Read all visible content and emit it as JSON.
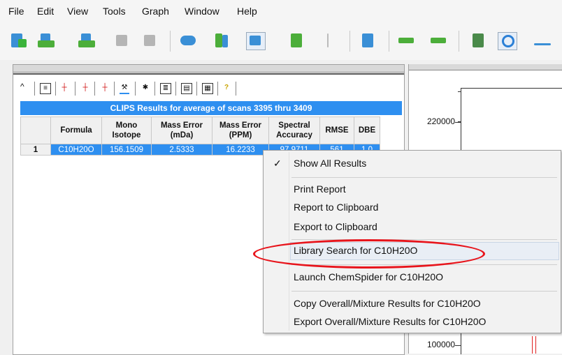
{
  "menu": [
    "File",
    "Edit",
    "View",
    "Tools",
    "Graph",
    "Window",
    "Help"
  ],
  "toolbar_icons": [
    "add-file-icon",
    "open-icon",
    "open-folder-icon",
    "save-icon",
    "copy-icon",
    "library-icon",
    "book-icon",
    "spectrum-icon",
    "document-icon",
    "peaks-icon",
    "chart-icon",
    "back-arrow-icon",
    "forward-arrow-icon",
    "integrate-icon",
    "search-icon",
    "baseline-icon"
  ],
  "mini_toolbar": {
    "caret": "^",
    "icons": [
      "list-icon",
      "peak-icon",
      "peak-range-icon",
      "peak-compare-icon",
      "tools-icon",
      "wand-icon",
      "stack-icon",
      "table-icon",
      "grid-icon",
      "help-icon"
    ],
    "help_label": "?"
  },
  "results": {
    "banner": "CLIPS Results for average of scans 3395 thru 3409",
    "headers": [
      {
        "l1": "Formula",
        "l2": ""
      },
      {
        "l1": "Mono",
        "l2": "Isotope"
      },
      {
        "l1": "Mass Error",
        "l2": "(mDa)"
      },
      {
        "l1": "Mass Error",
        "l2": "(PPM)"
      },
      {
        "l1": "Spectral",
        "l2": "Accuracy"
      },
      {
        "l1": "RMSE",
        "l2": ""
      },
      {
        "l1": "DBE",
        "l2": ""
      }
    ],
    "rows": [
      {
        "num": "1",
        "formula": "C10H20O",
        "mono": "156.1509",
        "err_mda": "2.5333",
        "err_ppm": "16.2233",
        "accuracy": "97.9711",
        "rmse": "561",
        "dbe": "1.0"
      }
    ]
  },
  "chart": {
    "y_tick_labels": [
      "220000",
      "100000"
    ]
  },
  "context_menu": {
    "items": [
      {
        "label": "Show All Results",
        "checked": true
      },
      {
        "label": "Print Report"
      },
      {
        "label": "Report to Clipboard"
      },
      {
        "label": "Export to Clipboard"
      },
      {
        "label": "Library Search for C10H20O",
        "highlighted": true
      },
      {
        "label": "Launch ChemSpider for C10H20O"
      },
      {
        "label": "Copy Overall/Mixture Results for C10H20O"
      },
      {
        "label": "Export Overall/Mixture Results for C10H20O"
      }
    ],
    "check_mark": "✓"
  },
  "colors": {
    "selection_blue": "#2e8ff0",
    "annotation_red": "#e8141b"
  }
}
